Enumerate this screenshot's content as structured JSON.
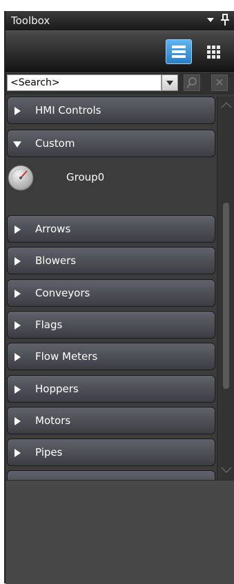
{
  "window": {
    "title": "Toolbox"
  },
  "toolbar": {
    "list_view": "list-view-icon",
    "grid_view": "grid-view-icon"
  },
  "search": {
    "value": "<Search>"
  },
  "categories": [
    {
      "label": "HMI Controls",
      "expanded": false
    },
    {
      "label": "Custom",
      "expanded": true,
      "items": [
        {
          "label": "Group0",
          "icon": "gauge-icon"
        }
      ]
    },
    {
      "label": "Arrows",
      "expanded": false
    },
    {
      "label": "Blowers",
      "expanded": false
    },
    {
      "label": "Conveyors",
      "expanded": false
    },
    {
      "label": "Flags",
      "expanded": false
    },
    {
      "label": "Flow Meters",
      "expanded": false
    },
    {
      "label": "Hoppers",
      "expanded": false
    },
    {
      "label": "Motors",
      "expanded": false
    },
    {
      "label": "Pipes",
      "expanded": false
    }
  ],
  "colors": {
    "accent": "#3a93da",
    "panel": "#3a3a3a",
    "item_bg": "#50525a"
  }
}
